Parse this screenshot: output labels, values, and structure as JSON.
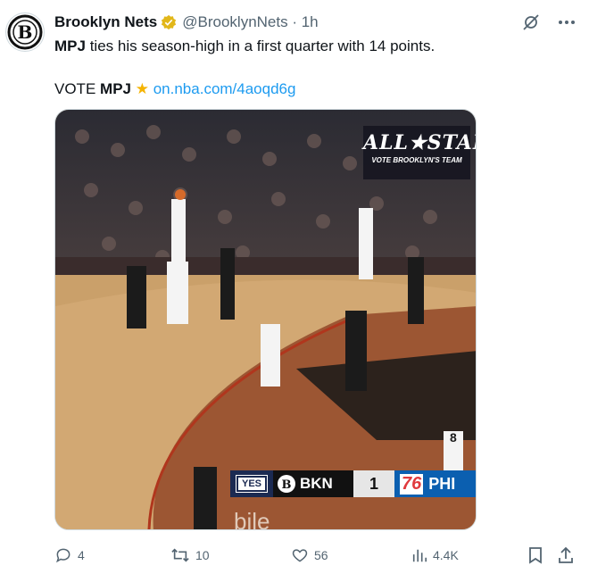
{
  "author": {
    "name": "Brooklyn Nets",
    "handle": "@BrooklynNets",
    "time": "1h",
    "avatar_icon": "brooklyn-nets-logo",
    "verified_color": "#e2b719"
  },
  "tweet": {
    "line1_bold": "MPJ",
    "line1_rest": "ties his season-high in a first quarter with 14 points.",
    "line2_prefix": "VOTE",
    "line2_bold": "MPJ",
    "line2_emoji": "★",
    "link": "on.nba.com/4aoqd6g",
    "link_color": "#1d9bf0"
  },
  "media": {
    "badge_title": "ALL★STAR",
    "badge_subtitle": "VOTE BROOKLYN'S TEAM",
    "scoreboard": {
      "sponsor": "YES",
      "team1": "BKN",
      "score": "1",
      "team2_logo": "76",
      "team2": "PHI"
    },
    "jersey_number": "8",
    "sign_text": "bile"
  },
  "stats": {
    "replies": "4",
    "reposts": "10",
    "likes": "56",
    "views": "4.4K"
  },
  "icons": {
    "grok": "grok-icon",
    "more": "more-icon",
    "reply": "reply-icon",
    "repost": "repost-icon",
    "like": "like-icon",
    "views": "views-icon",
    "bookmark": "bookmark-icon",
    "share": "share-icon"
  }
}
